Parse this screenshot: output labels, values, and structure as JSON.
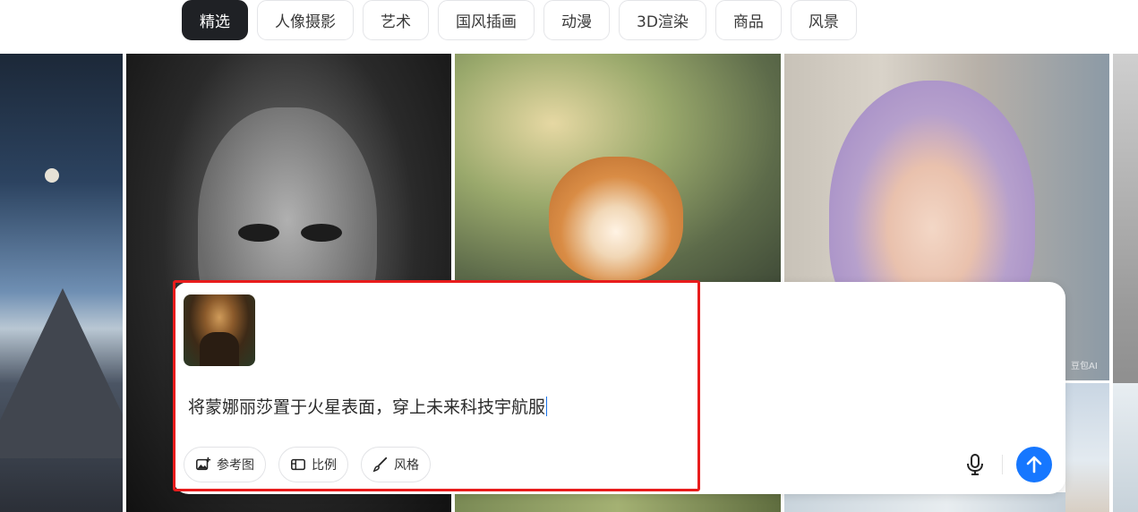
{
  "tabs": [
    {
      "label": "精选",
      "active": true
    },
    {
      "label": "人像摄影",
      "active": false
    },
    {
      "label": "艺术",
      "active": false
    },
    {
      "label": "国风插画",
      "active": false
    },
    {
      "label": "动漫",
      "active": false
    },
    {
      "label": "3D渲染",
      "active": false
    },
    {
      "label": "商品",
      "active": false
    },
    {
      "label": "风景",
      "active": false
    }
  ],
  "gallery": {
    "watermark": "豆包AI"
  },
  "prompt": {
    "text": "将蒙娜丽莎置于火星表面，穿上未来科技宇航服",
    "chips": {
      "reference": "参考图",
      "ratio": "比例",
      "style": "风格"
    }
  },
  "colors": {
    "accent": "#1677ff",
    "highlight": "#e81c1c",
    "active_tab": "#1f2125"
  },
  "icons": {
    "reference": "image-add-icon",
    "ratio": "aspect-ratio-icon",
    "style": "brush-icon",
    "mic": "microphone-icon",
    "send": "arrow-up-icon"
  }
}
